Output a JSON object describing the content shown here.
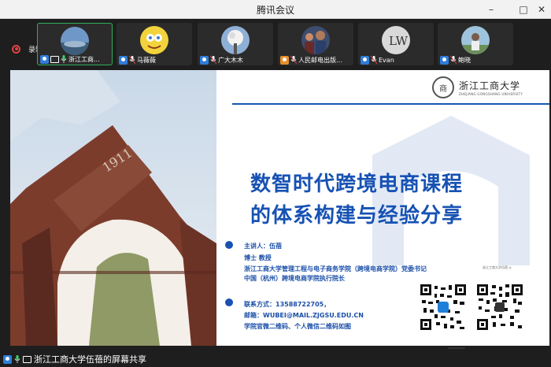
{
  "window": {
    "title": "腾讯会议",
    "minimize": "–",
    "maximize": "□",
    "close": "✕"
  },
  "recording": {
    "label": "录制中",
    "color": "#e04343"
  },
  "participants": [
    {
      "name": "浙江工商...",
      "avatar": "landscape-avatar",
      "active": true
    },
    {
      "name": "马薇薇",
      "avatar": "sponge-avatar",
      "active": false
    },
    {
      "name": "广大木木",
      "avatar": "tree-avatar",
      "active": false
    },
    {
      "name": "人民邮电出版...",
      "avatar": "crowd-avatar",
      "active": false
    },
    {
      "name": "Evan",
      "avatar": "letter-avatar",
      "active": false
    },
    {
      "name": "鲍晓",
      "avatar": "person-avatar",
      "active": false
    }
  ],
  "slide": {
    "logo_cn": "浙江工商大学",
    "logo_en": "ZHEJIANG GONGSHANG UNIVERSITY",
    "logo_seal": "商",
    "arch_year": "1911",
    "title_line1": "数智时代跨境电商课程",
    "title_line2": "的体系构建与经验分享",
    "speaker_label": "主讲人：伍蓓",
    "speaker_degree": "博士  教授",
    "speaker_affil1": "浙江工商大学管理工程与电子商务学院（跨境电商学院）党委书记",
    "speaker_affil2": "中国（杭州）跨境电商学院执行院长",
    "contact_phone": "联系方式：13588722705，",
    "contact_email": "邮箱：WUBEI@MAIL.ZJGSU.EDU.CN",
    "contact_qr": "学院官微二维码、个人微信二维码如图",
    "qr_caption": "浙江工商大学伍蓓 ◎",
    "accent": "#1752b3"
  },
  "share": {
    "label": "浙江工商大学伍蓓的屏幕共享"
  }
}
